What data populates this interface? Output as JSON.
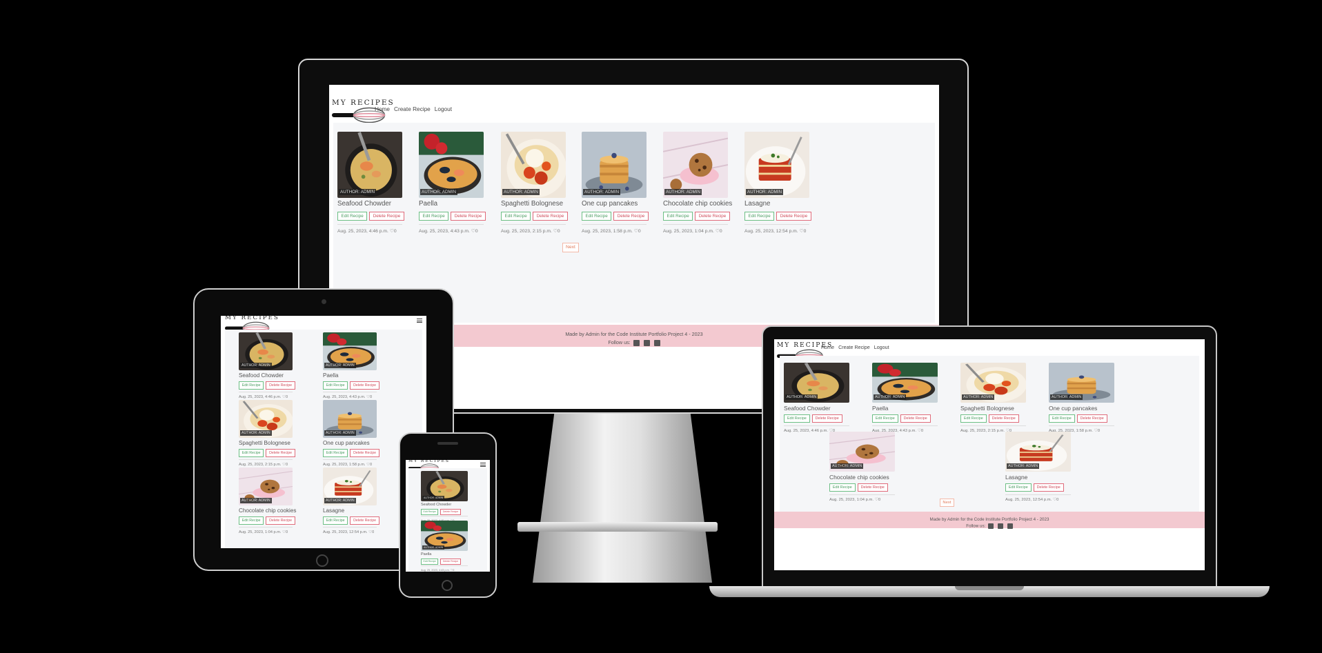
{
  "site": {
    "brand": "MY RECIPES",
    "nav": [
      "Home",
      "Create Recipe",
      "Logout"
    ],
    "edit_label": "Edit Recipe",
    "delete_label": "Delete Recipe",
    "author_badge": "AUTHOR: ADMIN",
    "next_label": "Next",
    "footer_text": "Made by Admin for the Code Institute Portfolio Project 4 - 2023",
    "follow_label": "Follow us:",
    "social_icons": [
      "facebook-icon",
      "instagram-icon",
      "twitter-icon"
    ]
  },
  "recipes": [
    {
      "title": "Seafood Chowder",
      "meta": "Aug. 25, 2023, 4:46 p.m. ♡0"
    },
    {
      "title": "Paella",
      "meta": "Aug. 25, 2023, 4:43 p.m. ♡0"
    },
    {
      "title": "Spaghetti Bolognese",
      "meta": "Aug. 25, 2023, 2:15 p.m. ♡0"
    },
    {
      "title": "One cup pancakes",
      "meta": "Aug. 25, 2023, 1:58 p.m. ♡0"
    },
    {
      "title": "Chocolate chip cookies",
      "meta": "Aug. 25, 2023, 1:04 p.m. ♡0"
    },
    {
      "title": "Lasagne",
      "meta": "Aug. 25, 2023, 12:54 p.m. ♡0"
    }
  ],
  "colors": {
    "background": "#000000",
    "footer_pink": "#f3c9d0",
    "edit_green": "#4a9d62",
    "delete_red": "#d04a5a",
    "pager_orange": "#e07a5a"
  }
}
